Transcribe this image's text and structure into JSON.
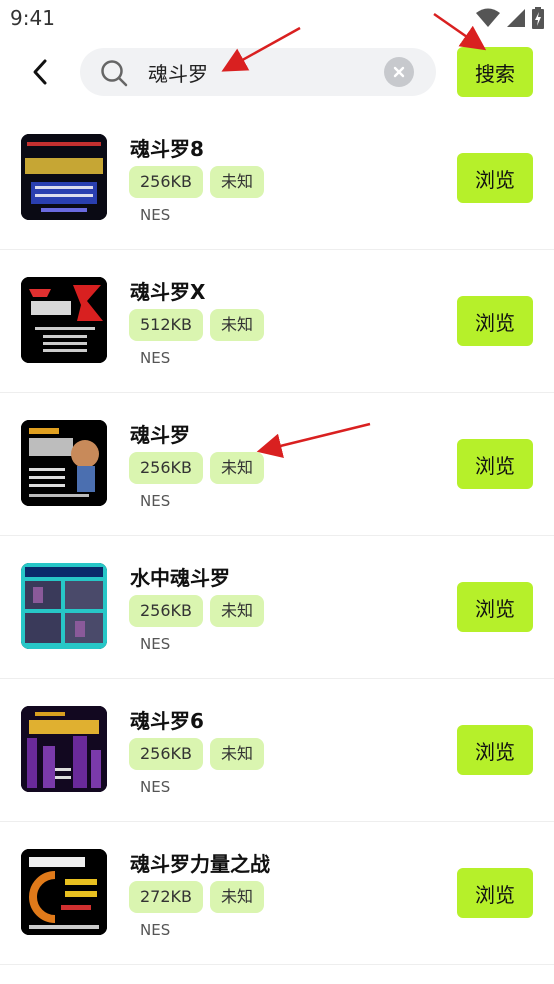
{
  "status": {
    "time": "9:41"
  },
  "search": {
    "query": "魂斗罗",
    "button_label": "搜索"
  },
  "results": [
    {
      "title": "魂斗罗8",
      "size": "256KB",
      "status": "未知",
      "platform": "NES",
      "browse_label": "浏览"
    },
    {
      "title": "魂斗罗X",
      "size": "512KB",
      "status": "未知",
      "platform": "NES",
      "browse_label": "浏览"
    },
    {
      "title": "魂斗罗",
      "size": "256KB",
      "status": "未知",
      "platform": "NES",
      "browse_label": "浏览"
    },
    {
      "title": "水中魂斗罗",
      "size": "256KB",
      "status": "未知",
      "platform": "NES",
      "browse_label": "浏览"
    },
    {
      "title": "魂斗罗6",
      "size": "256KB",
      "status": "未知",
      "platform": "NES",
      "browse_label": "浏览"
    },
    {
      "title": "魂斗罗力量之战",
      "size": "272KB",
      "status": "未知",
      "platform": "NES",
      "browse_label": "浏览"
    }
  ],
  "theme": {
    "accent": "#b6f02a",
    "tag_bg": "#daf5b0",
    "annotation_arrow": "#d92020"
  }
}
